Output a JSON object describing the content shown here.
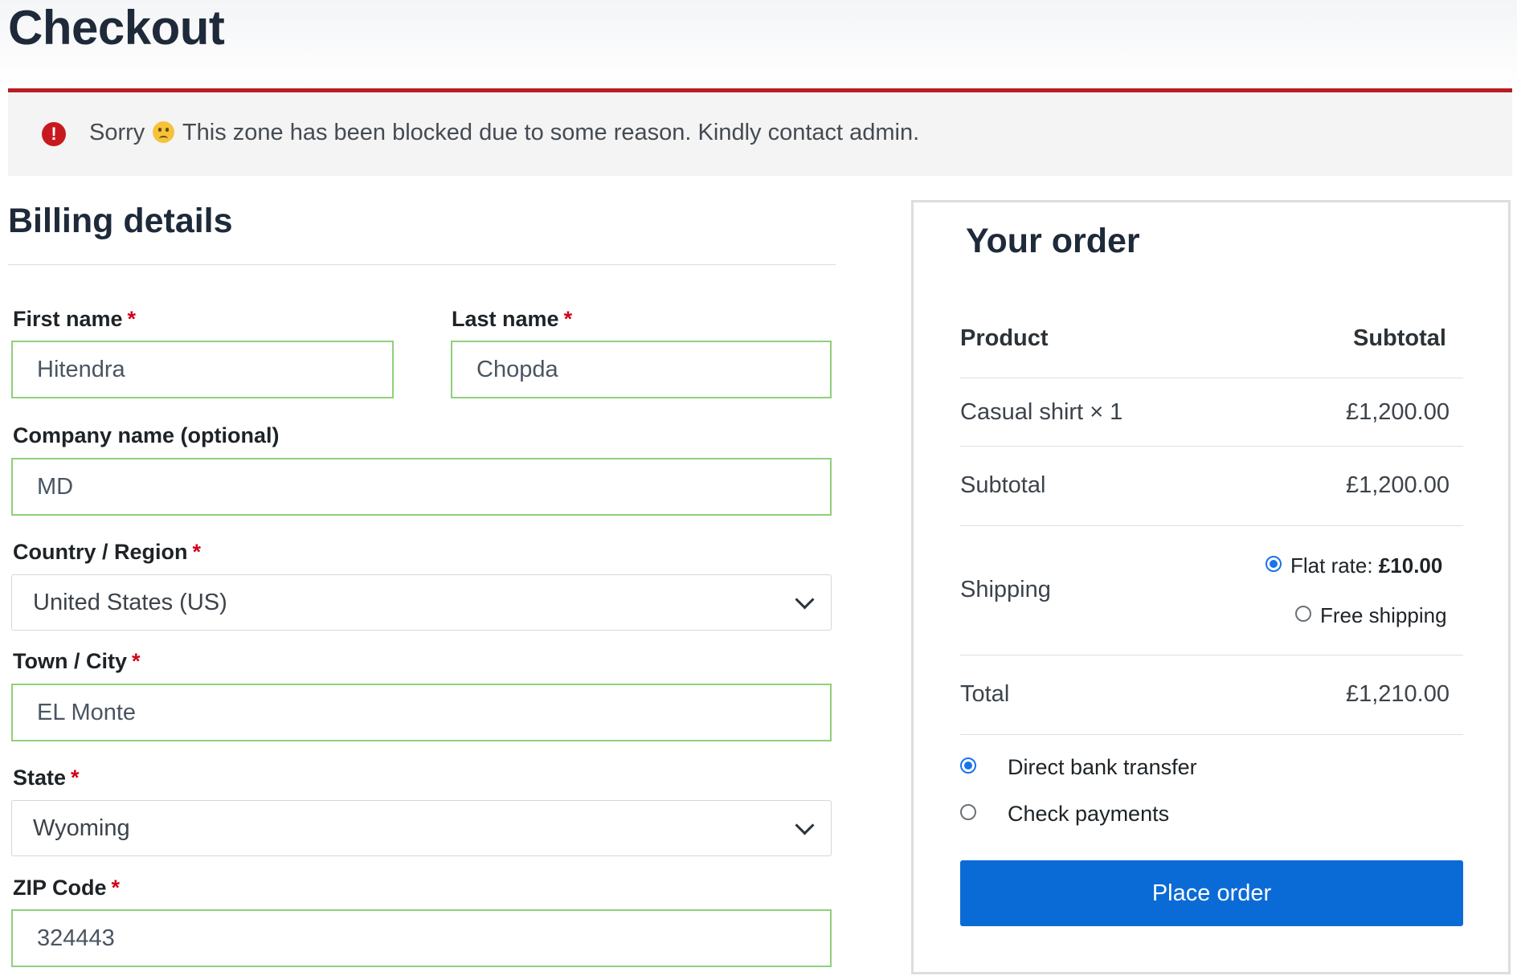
{
  "page": {
    "title": "Checkout"
  },
  "notice": {
    "text_before": "Sorry",
    "text_after": "This zone has been blocked due to some reason. Kindly contact admin.",
    "icon": "exclamation-circle-icon",
    "emoji": "confused-face-emoji",
    "accent_color": "#b81c23"
  },
  "billing": {
    "title": "Billing details",
    "required_marker": "*",
    "first_name": {
      "label": "First name",
      "value": "Hitendra"
    },
    "last_name": {
      "label": "Last name",
      "value": "Chopda"
    },
    "company": {
      "label": "Company name (optional)",
      "value": "MD"
    },
    "country": {
      "label": "Country / Region",
      "value": "United States (US)"
    },
    "city": {
      "label": "Town / City",
      "value": "EL Monte"
    },
    "state": {
      "label": "State",
      "value": "Wyoming"
    },
    "zip": {
      "label": "ZIP Code",
      "value": "324443"
    }
  },
  "order": {
    "title": "Your order",
    "header": {
      "product": "Product",
      "subtotal": "Subtotal"
    },
    "items": [
      {
        "name": "Casual shirt",
        "qty": "× 1",
        "price": "£1,200.00"
      }
    ],
    "subtotal": {
      "label": "Subtotal",
      "value": "£1,200.00"
    },
    "shipping": {
      "label": "Shipping",
      "options": [
        {
          "label": "Flat rate:",
          "price": "£10.00",
          "selected": true
        },
        {
          "label": "Free shipping",
          "selected": false
        }
      ]
    },
    "total": {
      "label": "Total",
      "value": "£1,210.00"
    },
    "payment_methods": [
      {
        "label": "Direct bank transfer",
        "selected": true
      },
      {
        "label": "Check payments",
        "selected": false
      }
    ],
    "place_order_label": "Place order",
    "button_color": "#0b6bd6"
  }
}
